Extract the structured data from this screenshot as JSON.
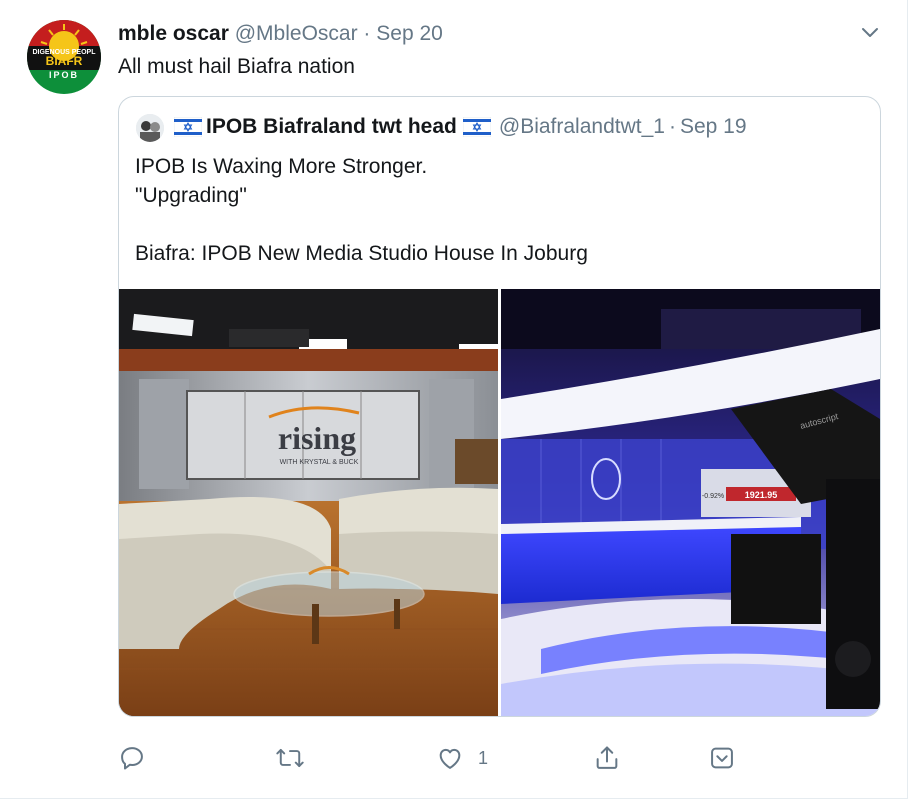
{
  "tweet": {
    "display_name": "mble oscar",
    "handle": "@MbleOscar",
    "separator": "·",
    "date": "Sep 20",
    "text": "All must hail Biafra nation",
    "avatar_lettering": {
      "top": "DIGENOUS PEOPL",
      "middle": "BIAFR",
      "bottom": "IPOB"
    }
  },
  "quoted_tweet": {
    "display_name": "IPOB Biafraland twt head",
    "handle": "@Biafralandtwt_1",
    "separator": "·",
    "date": "Sep 19",
    "lines": [
      "IPOB Is Waxing More Stronger.",
      "\"Upgrading\"",
      "",
      "Biafra: IPOB New Media Studio House In Joburg"
    ],
    "images": {
      "left_sign_text": "rising",
      "left_sign_subtext": "WITH KRYSTAL & BUCK",
      "right_ticker_text": "1921.95",
      "right_ticker_change": "-0.92%",
      "right_prompter_text": "autoscript"
    }
  },
  "actions": {
    "reply_icon": "reply-icon",
    "retweet_icon": "retweet-icon",
    "like_icon": "heart-icon",
    "like_count": "1",
    "share_icon": "share-icon",
    "bookmark_icon": "chevron-box-icon"
  },
  "colors": {
    "text_primary": "#14171a",
    "text_secondary": "#657786",
    "border": "#ccd6dd",
    "icon": "#657786"
  }
}
